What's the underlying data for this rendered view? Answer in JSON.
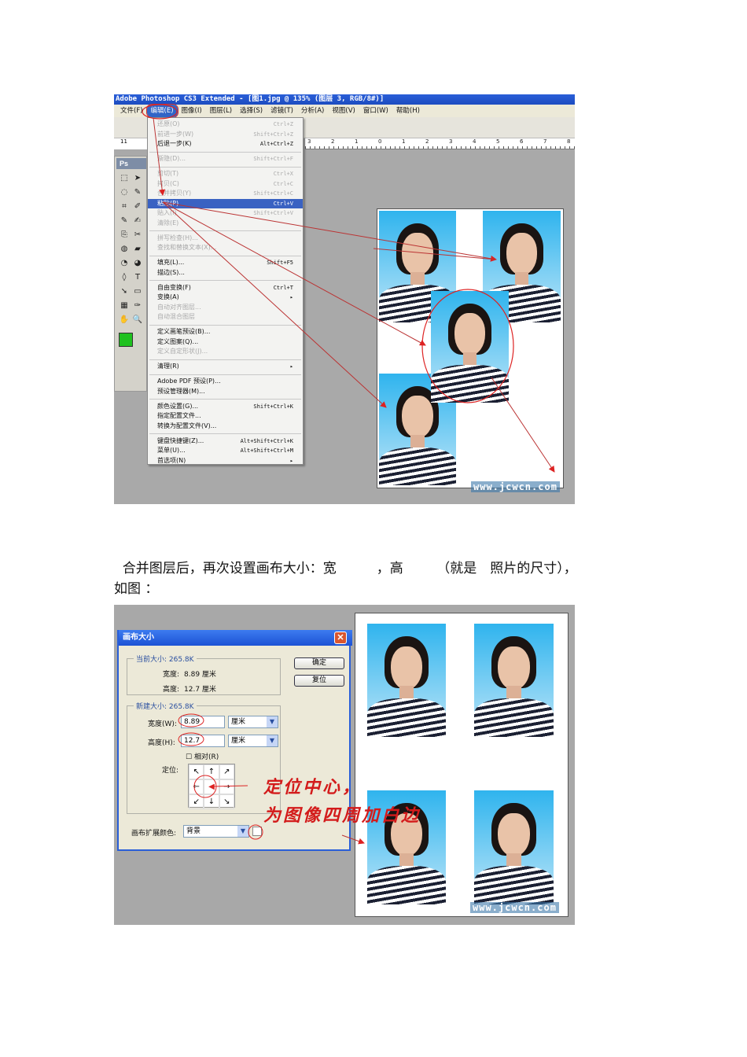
{
  "screenshot1": {
    "title": "Adobe Photoshop CS3 Extended - [图1.jpg @ 135% (图层 3, RGB/8#)]",
    "menubar": [
      "文件(F)",
      "编辑(E)",
      "图像(I)",
      "图层(L)",
      "选择(S)",
      "滤镜(T)",
      "分析(A)",
      "视图(V)",
      "窗口(W)",
      "帮助(H)"
    ],
    "active_menu": "编辑(E)",
    "ruler_left": "11",
    "ruler_ticks": [
      "3",
      "2",
      "1",
      "0",
      "1",
      "2",
      "3",
      "4",
      "5",
      "6",
      "7",
      "8"
    ],
    "toolbox_label": "Ps",
    "foreground_color": "#1fc11f",
    "edit_menu": [
      {
        "label": "还原(O)",
        "shortcut": "Ctrl+Z",
        "disabled": true
      },
      {
        "label": "前进一步(W)",
        "shortcut": "Shift+Ctrl+Z",
        "disabled": true
      },
      {
        "label": "后退一步(K)",
        "shortcut": "Alt+Ctrl+Z"
      },
      {
        "sep": true
      },
      {
        "label": "渐隐(D)...",
        "shortcut": "Shift+Ctrl+F",
        "disabled": true
      },
      {
        "sep": true
      },
      {
        "label": "剪切(T)",
        "shortcut": "Ctrl+X",
        "disabled": true
      },
      {
        "label": "拷贝(C)",
        "shortcut": "Ctrl+C",
        "disabled": true
      },
      {
        "label": "合并拷贝(Y)",
        "shortcut": "Shift+Ctrl+C",
        "disabled": true
      },
      {
        "label": "粘贴(P)",
        "shortcut": "Ctrl+V",
        "highlighted": true
      },
      {
        "label": "贴入(I)",
        "shortcut": "Shift+Ctrl+V",
        "disabled": true
      },
      {
        "label": "清除(E)",
        "shortcut": "",
        "disabled": true
      },
      {
        "sep": true
      },
      {
        "label": "拼写检查(H)...",
        "shortcut": "",
        "disabled": true
      },
      {
        "label": "查找和替换文本(X)...",
        "shortcut": "",
        "disabled": true
      },
      {
        "sep": true
      },
      {
        "label": "填充(L)...",
        "shortcut": "Shift+F5"
      },
      {
        "label": "描边(S)...",
        "shortcut": ""
      },
      {
        "sep": true
      },
      {
        "label": "自由变换(F)",
        "shortcut": "Ctrl+T"
      },
      {
        "label": "变换(A)",
        "shortcut": "▸"
      },
      {
        "label": "自动对齐图层...",
        "shortcut": "",
        "disabled": true
      },
      {
        "label": "自动混合图层",
        "shortcut": "",
        "disabled": true
      },
      {
        "sep": true
      },
      {
        "label": "定义画笔预设(B)...",
        "shortcut": ""
      },
      {
        "label": "定义图案(Q)...",
        "shortcut": ""
      },
      {
        "label": "定义自定形状(J)...",
        "shortcut": "",
        "disabled": true
      },
      {
        "sep": true
      },
      {
        "label": "清理(R)",
        "shortcut": "▸"
      },
      {
        "sep": true
      },
      {
        "label": "Adobe PDF 预设(P)...",
        "shortcut": ""
      },
      {
        "label": "预设管理器(M)...",
        "shortcut": ""
      },
      {
        "sep": true
      },
      {
        "label": "颜色设置(G)...",
        "shortcut": "Shift+Ctrl+K"
      },
      {
        "label": "指定配置文件...",
        "shortcut": ""
      },
      {
        "label": "转换为配置文件(V)...",
        "shortcut": ""
      },
      {
        "sep": true
      },
      {
        "label": "键盘快捷键(Z)...",
        "shortcut": "Alt+Shift+Ctrl+K"
      },
      {
        "label": "菜单(U)...",
        "shortcut": "Alt+Shift+Ctrl+M"
      },
      {
        "label": "首选项(N)",
        "shortcut": "▸"
      }
    ],
    "watermark": "www.jcwcn.com"
  },
  "paragraph": {
    "line1": "  合并图层后，再次设置画布大小：宽　　　，高　　　（就是　照片的尺寸），",
    "line2": "如图 ："
  },
  "screenshot2": {
    "dialog": {
      "title": "画布大小",
      "current_size_label": "当前大小: 265.8K",
      "current_width_label": "宽度:",
      "current_width": "8.89 厘米",
      "current_height_label": "高度:",
      "current_height": "12.7 厘米",
      "new_size_label": "新建大小: 265.8K",
      "width_label": "宽度(W):",
      "width_value": "8.89",
      "width_unit": "厘米",
      "height_label": "高度(H):",
      "height_value": "12.7",
      "height_unit": "厘米",
      "relative_label": "相对(R)",
      "anchor_label": "定位:",
      "extension_color_label": "画布扩展颜色:",
      "extension_color_value": "背景",
      "ok_button": "确定",
      "reset_button": "复位"
    },
    "annotation_line1": "定位中心，",
    "annotation_line2": "为图像四周加白边",
    "watermark": "www.jcwcn.com"
  }
}
